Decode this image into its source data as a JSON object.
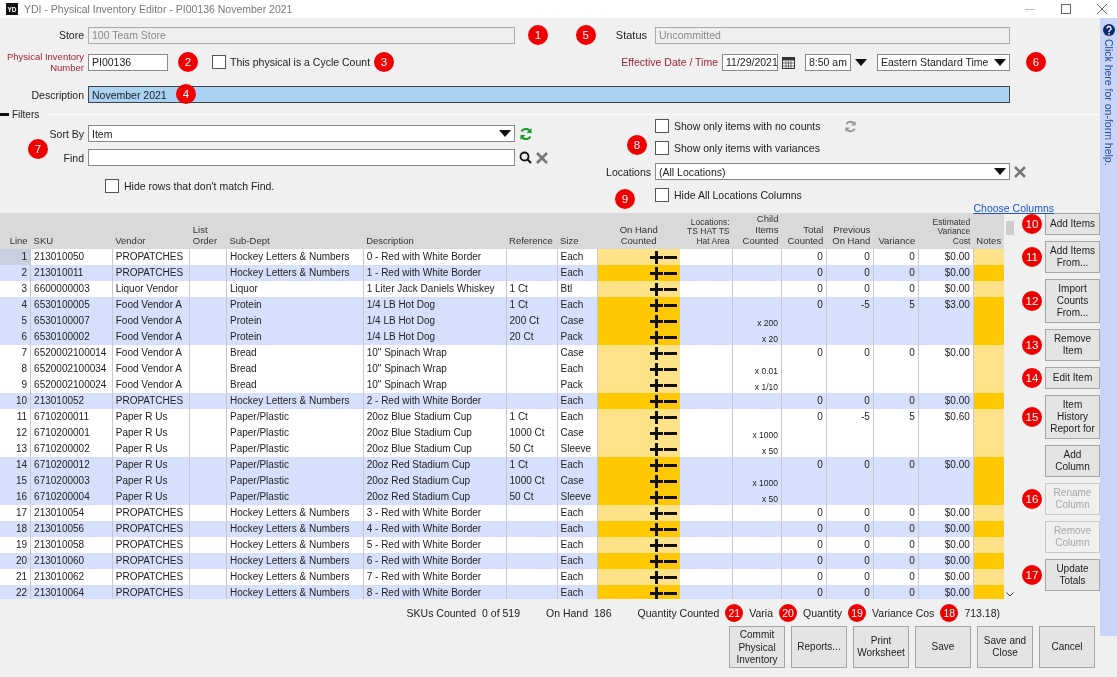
{
  "window": {
    "logo": "YD",
    "title": "YDI - Physical Inventory Editor - PI00136 November 2021"
  },
  "callouts": [
    "1",
    "2",
    "3",
    "4",
    "5",
    "6",
    "7",
    "8",
    "9"
  ],
  "form": {
    "store_label": "Store",
    "store": {
      "value": "100 Team Store",
      "disabled": true
    },
    "status_label": "Status",
    "status": {
      "value": "Uncommitted",
      "disabled": true
    },
    "number_label": "Physical Inventory Number",
    "number": "PI00136",
    "cycle_count": {
      "label": "This physical is a Cycle Count",
      "checked": false
    },
    "date_label": "Effective Date / Time",
    "date": "11/29/2021",
    "time": "8:50 am",
    "timezone": "Eastern Standard Time",
    "description_label": "Description",
    "description": "November 2021"
  },
  "filters": {
    "title": "Filters",
    "sort_label": "Sort By",
    "sort": "Item",
    "find_label": "Find",
    "hide_unmatched": {
      "label": "Hide rows that don't match Find.",
      "checked": false
    },
    "no_counts": {
      "label": "Show only items with no counts",
      "checked": false
    },
    "variances": {
      "label": "Show only items with variances",
      "checked": false
    },
    "locations_label": "Locations",
    "locations": "(All Locations)",
    "hide_locations": {
      "label": "Hide All Locations Columns",
      "checked": false
    },
    "choose_columns": "Choose Columns"
  },
  "table": {
    "columns": [
      "Line",
      "SKU",
      "Vendor",
      "List Order",
      "Sub-Dept",
      "Description",
      "Reference",
      "Size",
      "On Hand Counted",
      "Locations: TS HAT TS Hat Area",
      "Child Items Counted",
      "Total Counted",
      "Previous On Hand",
      "Variance",
      "Estimated Variance Cost",
      "Notes"
    ],
    "rows": [
      {
        "line": "1",
        "sku": "213010050",
        "vendor": "PROPATCHES",
        "sub_dept": "Hockey Letters & Numbers",
        "description": "0 - Red with White Border",
        "size": "Each",
        "total_counted": "0",
        "previous_on_hand": "0",
        "variance": "0",
        "variance_cost": "$0.00",
        "shaded": false,
        "selected": true
      },
      {
        "line": "2",
        "sku": "213010011",
        "vendor": "PROPATCHES",
        "sub_dept": "Hockey Letters & Numbers",
        "description": "1 - Red with White Border",
        "size": "Each",
        "total_counted": "0",
        "previous_on_hand": "0",
        "variance": "0",
        "variance_cost": "$0.00",
        "shaded": true,
        "selected": false
      },
      {
        "line": "3",
        "sku": "6600000003",
        "vendor": "Liquor Vendor",
        "sub_dept": "Liquor",
        "description": "1 Liter Jack Daniels Whiskey",
        "reference": "1 Ct",
        "size": "Btl",
        "total_counted": "0",
        "previous_on_hand": "0",
        "variance": "0",
        "variance_cost": "$0.00",
        "shaded": false,
        "selected": false
      },
      {
        "line": "4",
        "sku": "6530100005",
        "vendor": "Food Vendor A",
        "sub_dept": "Protein",
        "description": "1/4 LB Hot Dog",
        "reference": "1 Ct",
        "size": "Each",
        "total_counted": "0",
        "previous_on_hand": "-5",
        "variance": "5",
        "variance_cost": "$3.00",
        "shaded": true,
        "selected": false
      },
      {
        "line": "5",
        "sku": "6530100007",
        "vendor": "Food Vendor A",
        "sub_dept": "Protein",
        "description": "1/4 LB Hot Dog",
        "reference": "200 Ct",
        "size": "Case",
        "child_counted": "x 200",
        "shaded": true,
        "selected": false
      },
      {
        "line": "6",
        "sku": "6530100002",
        "vendor": "Food Vendor A",
        "sub_dept": "Protein",
        "description": "1/4 LB Hot Dog",
        "reference": "20 Ct",
        "size": "Pack",
        "child_counted": "x 20",
        "shaded": true,
        "selected": false
      },
      {
        "line": "7",
        "sku": "6520002100014",
        "vendor": "Food Vendor A",
        "sub_dept": "Bread",
        "description": "10\" Spinach Wrap",
        "size": "Case",
        "total_counted": "0",
        "previous_on_hand": "0",
        "variance": "0",
        "variance_cost": "$0.00",
        "shaded": false,
        "selected": false
      },
      {
        "line": "8",
        "sku": "6520002100034",
        "vendor": "Food Vendor A",
        "sub_dept": "Bread",
        "description": "10\" Spinach Wrap",
        "size": "Each",
        "child_counted": "x 0.01",
        "shaded": false,
        "selected": false
      },
      {
        "line": "9",
        "sku": "6520002100024",
        "vendor": "Food Vendor A",
        "sub_dept": "Bread",
        "description": "10\" Spinach Wrap",
        "size": "Pack",
        "child_counted": "x 1/10",
        "shaded": false,
        "selected": false
      },
      {
        "line": "10",
        "sku": "213010052",
        "vendor": "PROPATCHES",
        "sub_dept": "Hockey Letters & Numbers",
        "description": "2 - Red with White Border",
        "size": "Each",
        "total_counted": "0",
        "previous_on_hand": "0",
        "variance": "0",
        "variance_cost": "$0.00",
        "shaded": true,
        "selected": false
      },
      {
        "line": "11",
        "sku": "6710200011",
        "vendor": "Paper R Us",
        "sub_dept": "Paper/Plastic",
        "description": "20oz Blue Stadium Cup",
        "reference": "1 Ct",
        "size": "Each",
        "total_counted": "0",
        "previous_on_hand": "-5",
        "variance": "5",
        "variance_cost": "$0.60",
        "shaded": false,
        "selected": false
      },
      {
        "line": "12",
        "sku": "6710200001",
        "vendor": "Paper R Us",
        "sub_dept": "Paper/Plastic",
        "description": "20oz Blue Stadium Cup",
        "reference": "1000 Ct",
        "size": "Case",
        "child_counted": "x 1000",
        "shaded": false,
        "selected": false
      },
      {
        "line": "13",
        "sku": "6710200002",
        "vendor": "Paper R Us",
        "sub_dept": "Paper/Plastic",
        "description": "20oz Blue Stadium Cup",
        "reference": "50 Ct",
        "size": "Sleeve",
        "child_counted": "x 50",
        "shaded": false,
        "selected": false
      },
      {
        "line": "14",
        "sku": "6710200012",
        "vendor": "Paper R Us",
        "sub_dept": "Paper/Plastic",
        "description": "20oz Red Stadium Cup",
        "reference": "1 Ct",
        "size": "Each",
        "total_counted": "0",
        "previous_on_hand": "0",
        "variance": "0",
        "variance_cost": "$0.00",
        "shaded": true,
        "selected": false
      },
      {
        "line": "15",
        "sku": "6710200003",
        "vendor": "Paper R Us",
        "sub_dept": "Paper/Plastic",
        "description": "20oz Red Stadium Cup",
        "reference": "1000 Ct",
        "size": "Case",
        "child_counted": "x 1000",
        "shaded": true,
        "selected": false
      },
      {
        "line": "16",
        "sku": "6710200004",
        "vendor": "Paper R Us",
        "sub_dept": "Paper/Plastic",
        "description": "20oz Red Stadium Cup",
        "reference": "50 Ct",
        "size": "Sleeve",
        "child_counted": "x 50",
        "shaded": true,
        "selected": false
      },
      {
        "line": "17",
        "sku": "213010054",
        "vendor": "PROPATCHES",
        "sub_dept": "Hockey Letters & Numbers",
        "description": "3 - Red with White Border",
        "size": "Each",
        "total_counted": "0",
        "previous_on_hand": "0",
        "variance": "0",
        "variance_cost": "$0.00",
        "shaded": false,
        "selected": false
      },
      {
        "line": "18",
        "sku": "213010056",
        "vendor": "PROPATCHES",
        "sub_dept": "Hockey Letters & Numbers",
        "description": "4 - Red with White Border",
        "size": "Each",
        "total_counted": "0",
        "previous_on_hand": "0",
        "variance": "0",
        "variance_cost": "$0.00",
        "shaded": true,
        "selected": false
      },
      {
        "line": "19",
        "sku": "213010058",
        "vendor": "PROPATCHES",
        "sub_dept": "Hockey Letters & Numbers",
        "description": "5 - Red with White Border",
        "size": "Each",
        "total_counted": "0",
        "previous_on_hand": "0",
        "variance": "0",
        "variance_cost": "$0.00",
        "shaded": false,
        "selected": false
      },
      {
        "line": "20",
        "sku": "213010060",
        "vendor": "PROPATCHES",
        "sub_dept": "Hockey Letters & Numbers",
        "description": "6 - Red with White Border",
        "size": "Each",
        "total_counted": "0",
        "previous_on_hand": "0",
        "variance": "0",
        "variance_cost": "$0.00",
        "shaded": true,
        "selected": false
      },
      {
        "line": "21",
        "sku": "213010062",
        "vendor": "PROPATCHES",
        "sub_dept": "Hockey Letters & Numbers",
        "description": "7 - Red with White Border",
        "size": "Each",
        "total_counted": "0",
        "previous_on_hand": "0",
        "variance": "0",
        "variance_cost": "$0.00",
        "shaded": false,
        "selected": false
      },
      {
        "line": "22",
        "sku": "213010064",
        "vendor": "PROPATCHES",
        "sub_dept": "Hockey Letters & Numbers",
        "description": "8 - Red with White Border",
        "size": "Each",
        "total_counted": "0",
        "previous_on_hand": "0",
        "variance": "0",
        "variance_cost": "$0.00",
        "shaded": true,
        "selected": false
      }
    ]
  },
  "side_buttons": [
    {
      "label": "Add Items",
      "disabled": false,
      "callout": "10"
    },
    {
      "label": "Add Items From...",
      "disabled": false,
      "callout": "11"
    },
    {
      "label": "Import Counts From...",
      "disabled": false,
      "callout": "12"
    },
    {
      "label": "Remove Item",
      "disabled": false,
      "callout": "13"
    },
    {
      "label": "Edit Item",
      "disabled": false,
      "callout": "14"
    },
    {
      "label": "Item History Report for",
      "disabled": false,
      "callout": "15"
    },
    {
      "label": "Add Column",
      "disabled": false
    },
    {
      "label": "Rename Column",
      "disabled": true,
      "callout": "16"
    },
    {
      "label": "Remove Column",
      "disabled": true
    },
    {
      "label": "Update Totals",
      "disabled": false,
      "callout": "17"
    }
  ],
  "summary": [
    {
      "kind": "text",
      "text": "SKUs Counted"
    },
    {
      "kind": "value",
      "text": "0 of 519"
    },
    {
      "kind": "text",
      "text": "On Hand"
    },
    {
      "kind": "value",
      "text": "186"
    },
    {
      "kind": "text",
      "text": "Quantity Counted"
    },
    {
      "kind": "callout",
      "text": "21"
    },
    {
      "kind": "text",
      "text": "Varia"
    },
    {
      "kind": "callout",
      "text": "20"
    },
    {
      "kind": "text",
      "text": "Quantity"
    },
    {
      "kind": "callout",
      "text": "19"
    },
    {
      "kind": "text",
      "text": "Variance Cos"
    },
    {
      "kind": "callout",
      "text": "18"
    },
    {
      "kind": "value",
      "text": "713.18)"
    }
  ],
  "bottom_buttons": [
    "Commit Physical Inventory",
    "Reports...",
    "Print Worksheet",
    "Save",
    "Save and Close",
    "Cancel"
  ],
  "help": "Click here for on-form help."
}
